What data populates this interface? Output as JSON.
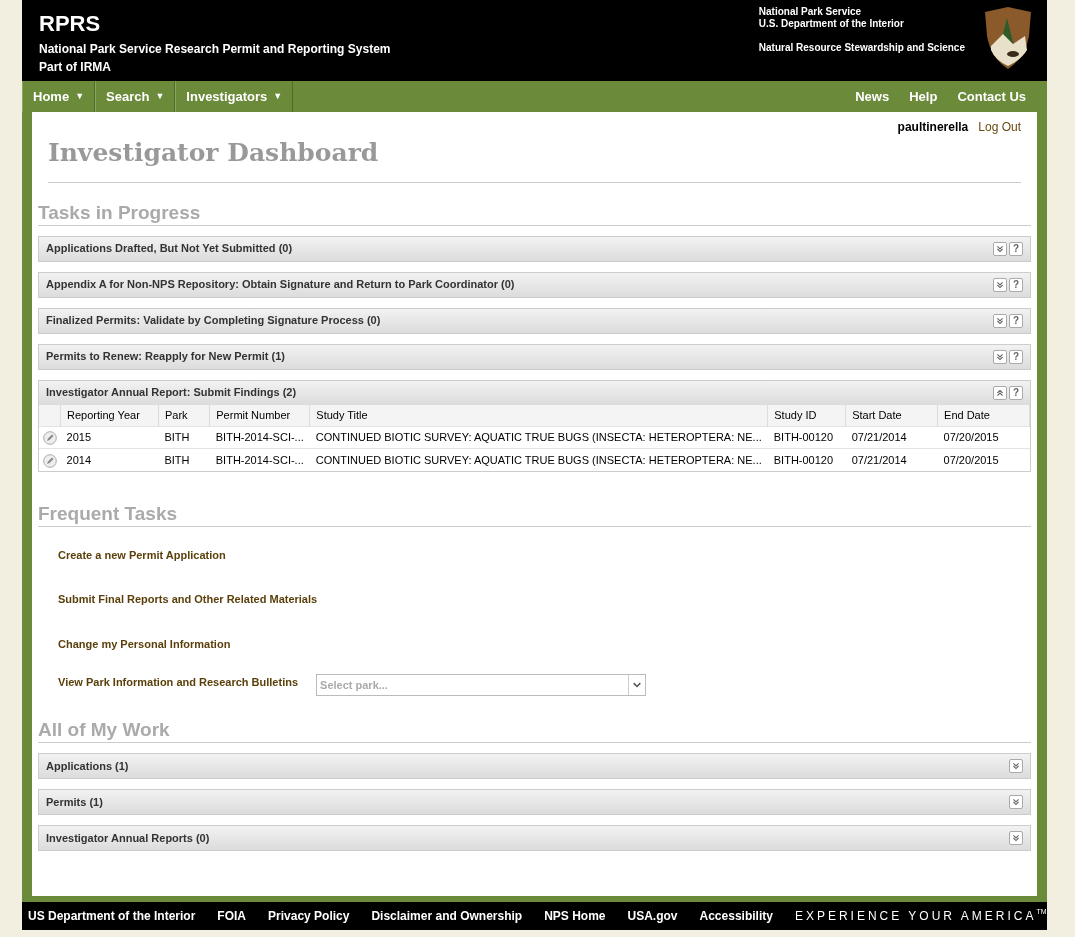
{
  "header": {
    "title": "RPRS",
    "subtitle": "National Park Service Research Permit and Reporting System",
    "part_of": "Part of IRMA",
    "agency_lines": [
      "National Park Service",
      "U.S. Department of the Interior"
    ],
    "program": "Natural Resource Stewardship and Science"
  },
  "nav": {
    "left": [
      {
        "label": "Home",
        "caret": "▼"
      },
      {
        "label": "Search",
        "caret": "▼"
      },
      {
        "label": "Investigators",
        "caret": "▼"
      }
    ],
    "right": [
      "News",
      "Help",
      "Contact Us"
    ]
  },
  "user": {
    "name": "paultinerella",
    "logout": "Log Out"
  },
  "page_title": "Investigator Dashboard",
  "tasks_in_progress": {
    "heading": "Tasks in Progress",
    "panels": [
      {
        "title": "Applications Drafted, But Not Yet Submitted (0)",
        "expanded": false,
        "help": "?"
      },
      {
        "title": "Appendix A for Non-NPS Repository: Obtain Signature and Return to Park Coordinator (0)",
        "expanded": false,
        "help": "?"
      },
      {
        "title": "Finalized Permits: Validate by Completing Signature Process (0)",
        "expanded": false,
        "help": "?"
      },
      {
        "title": "Permits to Renew: Reapply for New Permit (1)",
        "expanded": false,
        "help": "?"
      },
      {
        "title": "Investigator Annual Report: Submit Findings (2)",
        "expanded": true,
        "help": "?",
        "table": {
          "columns": [
            "Reporting Year",
            "Park",
            "Permit Number",
            "Study Title",
            "Study ID",
            "Start Date",
            "End Date"
          ],
          "rows": [
            [
              "2015",
              "BITH",
              "BITH-2014-SCI-...",
              "CONTINUED BIOTIC SURVEY: AQUATIC TRUE BUGS (INSECTA: HETEROPTERA: NE...",
              "BITH-00120",
              "07/21/2014",
              "07/20/2015"
            ],
            [
              "2014",
              "BITH",
              "BITH-2014-SCI-...",
              "CONTINUED BIOTIC SURVEY: AQUATIC TRUE BUGS (INSECTA: HETEROPTERA: NE...",
              "BITH-00120",
              "07/21/2014",
              "07/20/2015"
            ]
          ]
        }
      }
    ]
  },
  "frequent_tasks": {
    "heading": "Frequent Tasks",
    "links": [
      "Create a new Permit Application",
      "Submit Final Reports and Other Related Materials",
      "Change my Personal Information"
    ],
    "park_bulletins": {
      "label": "View Park Information and Research Bulletins",
      "placeholder": "Select park..."
    }
  },
  "all_of_my_work": {
    "heading": "All of My Work",
    "panels": [
      {
        "title": "Applications (1)",
        "expanded": false
      },
      {
        "title": "Permits (1)",
        "expanded": false
      },
      {
        "title": "Investigator Annual Reports (0)",
        "expanded": false
      }
    ]
  },
  "footer": {
    "links": [
      "US Department of the Interior",
      "FOIA",
      "Privacy Policy",
      "Disclaimer and Ownership",
      "NPS Home",
      "USA.gov",
      "Accessibility"
    ],
    "slogan": "EXPERIENCE YOUR AMERICA",
    "slogan_mark": "TM"
  }
}
